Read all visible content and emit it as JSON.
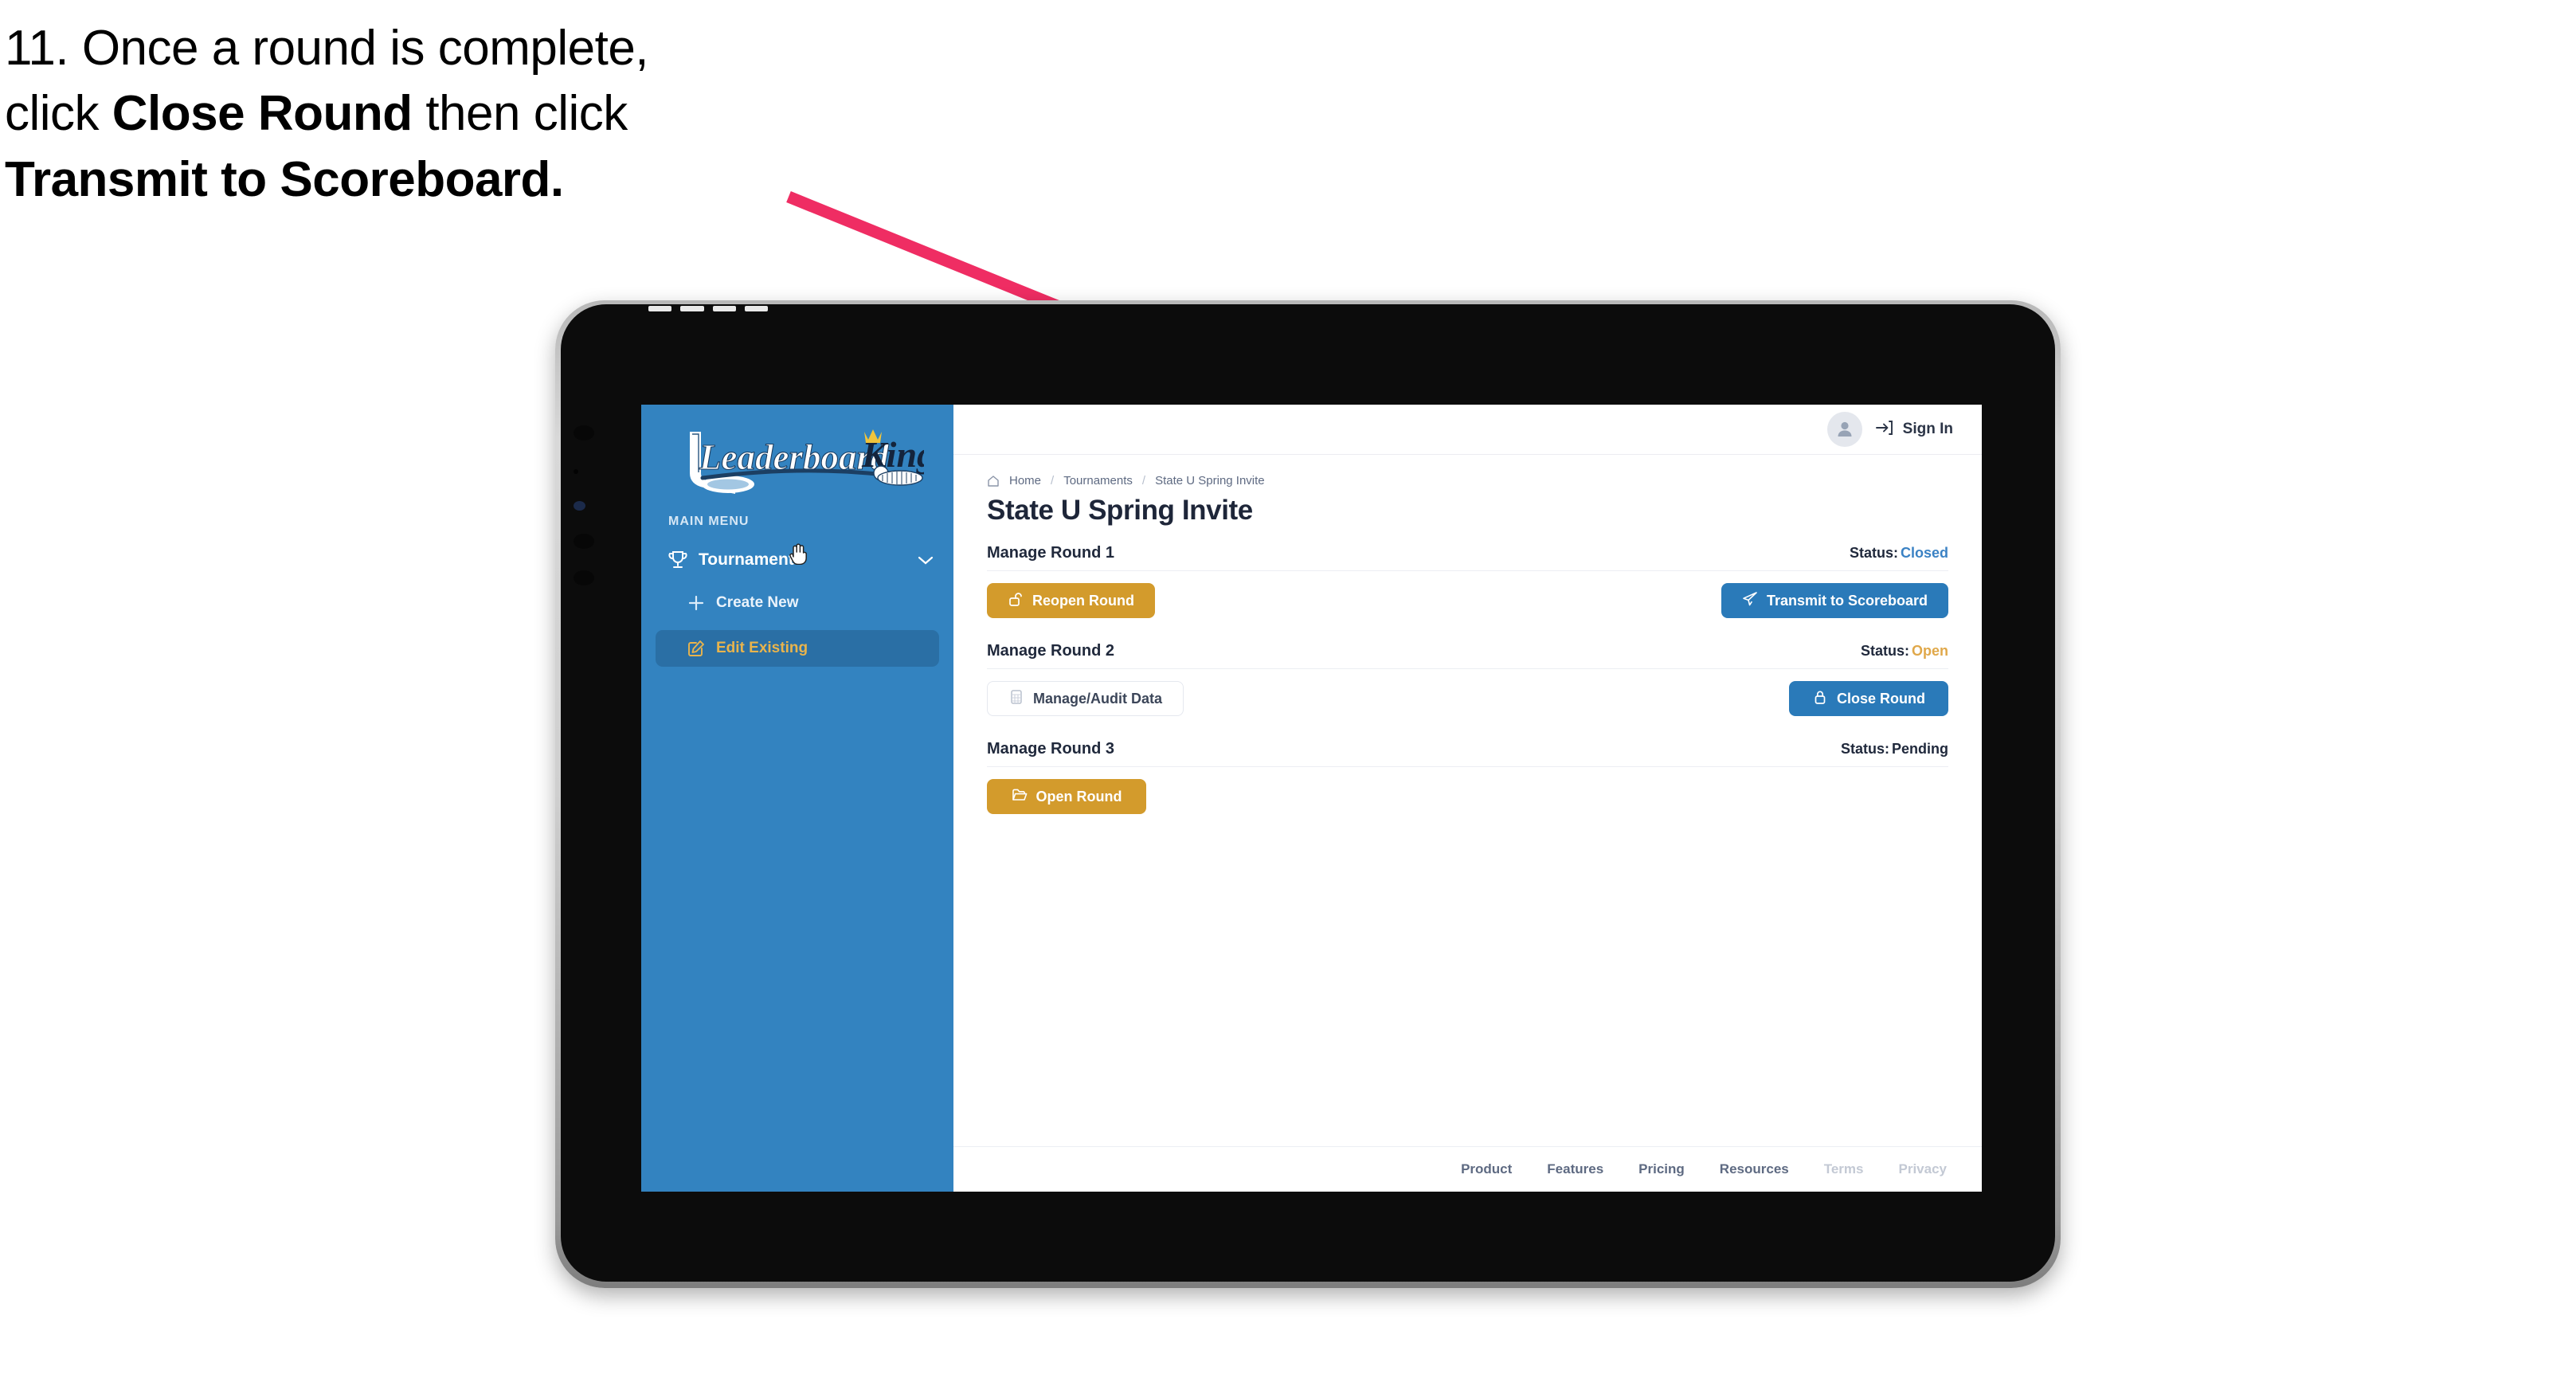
{
  "instruction": {
    "step_number": "11.",
    "line1_a": "11. Once a round is complete,",
    "line2_a": "click ",
    "line2_bold": "Close Round",
    "line2_b": " then click",
    "line3_bold": "Transmit to Scoreboard."
  },
  "annotation": {
    "arrow_color": "#EF2D63",
    "points_to": "transmit-to-scoreboard-button"
  },
  "app": {
    "logo_text_primary": "Leaderboard",
    "logo_text_secondary": "King",
    "brand_blue": "#3383C0",
    "brand_gold": "#D39B2C",
    "accent_blue": "#2A7AB9"
  },
  "sidebar": {
    "section_label": "MAIN MENU",
    "group": {
      "label": "Tournaments",
      "icon": "trophy-icon",
      "chevron": "chevron-down-icon",
      "expanded": true
    },
    "items": [
      {
        "label": "Create New",
        "icon": "plus-icon",
        "active": false
      },
      {
        "label": "Edit Existing",
        "icon": "edit-square-icon",
        "active": true
      }
    ]
  },
  "topbar": {
    "avatar_icon": "user-avatar-icon",
    "signin_icon": "login-arrow-icon",
    "signin_label": "Sign In"
  },
  "breadcrumb": {
    "home_icon": "home-icon",
    "items": [
      "Home",
      "Tournaments",
      "State U Spring Invite"
    ],
    "separator": "/"
  },
  "page": {
    "title": "State U Spring Invite"
  },
  "rounds": [
    {
      "title": "Manage Round 1",
      "status_label": "Status:",
      "status_value": "Closed",
      "status_class": "status-closed",
      "left_button": {
        "label": "Reopen Round",
        "icon": "unlock-icon",
        "style": "gold"
      },
      "right_button": {
        "label": "Transmit to Scoreboard",
        "icon": "paper-plane-icon",
        "style": "blue"
      }
    },
    {
      "title": "Manage Round 2",
      "status_label": "Status:",
      "status_value": "Open",
      "status_class": "status-open",
      "left_button": {
        "label": "Manage/Audit Data",
        "icon": "table-grid-icon",
        "style": "ghost"
      },
      "right_button": {
        "label": "Close Round",
        "icon": "lock-icon",
        "style": "blue"
      }
    },
    {
      "title": "Manage Round 3",
      "status_label": "Status:",
      "status_value": "Pending",
      "status_class": "status-pending",
      "left_button": {
        "label": "Open Round",
        "icon": "folder-open-icon",
        "style": "gold"
      },
      "right_button": null
    }
  ],
  "footer": {
    "links": [
      {
        "label": "Product",
        "muted": false
      },
      {
        "label": "Features",
        "muted": false
      },
      {
        "label": "Pricing",
        "muted": false
      },
      {
        "label": "Resources",
        "muted": false
      },
      {
        "label": "Terms",
        "muted": true
      },
      {
        "label": "Privacy",
        "muted": true
      }
    ]
  },
  "cursor": {
    "type": "pointing-hand-cursor",
    "over": "edit-existing-menu-item"
  }
}
